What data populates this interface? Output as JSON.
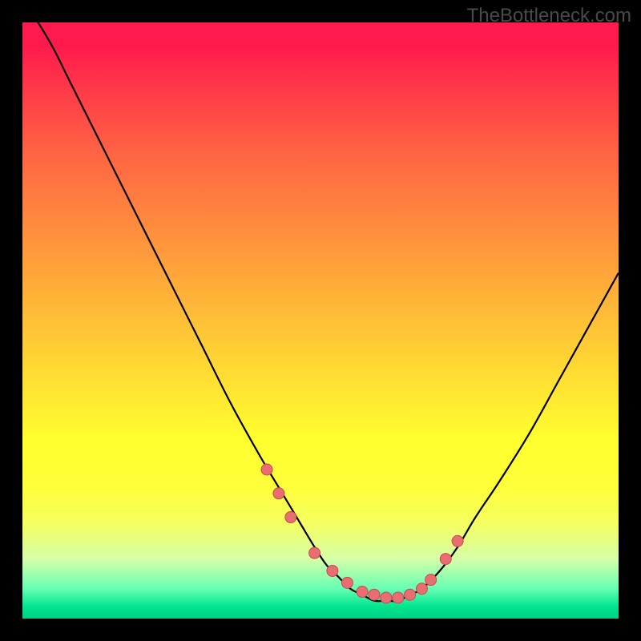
{
  "watermark": "TheBottleneck.com",
  "colors": {
    "marker_fill": "#e96e72",
    "marker_stroke": "#c84a50",
    "curve_stroke": "#000000"
  },
  "chart_data": {
    "type": "line",
    "title": "",
    "xlabel": "",
    "ylabel": "",
    "xlim": [
      0,
      100
    ],
    "ylim": [
      0,
      100
    ],
    "grid": false,
    "legend": false,
    "series": [
      {
        "name": "bottleneck-curve",
        "x": [
          0,
          2,
          5,
          8,
          12,
          16,
          20,
          25,
          30,
          35,
          40,
          43,
          46,
          49,
          51,
          53,
          55,
          57,
          59,
          61,
          63,
          65,
          67,
          70,
          73,
          76,
          80,
          85,
          90,
          95,
          100
        ],
        "y": [
          104,
          101,
          96,
          90,
          82,
          74,
          66,
          56,
          46,
          36,
          27,
          22,
          17,
          12,
          9,
          7,
          5,
          4,
          3,
          3,
          3,
          4,
          5,
          8,
          12,
          17,
          23,
          31,
          40,
          49,
          58
        ]
      }
    ],
    "markers": {
      "name": "highlight-points",
      "x": [
        41,
        43,
        45,
        49,
        52,
        54.5,
        57,
        59,
        61,
        63,
        65,
        67,
        68.5,
        71,
        73
      ],
      "y": [
        25,
        21,
        17,
        11,
        8,
        6,
        4.5,
        4,
        3.5,
        3.5,
        4,
        5,
        6.5,
        10,
        13
      ]
    }
  }
}
